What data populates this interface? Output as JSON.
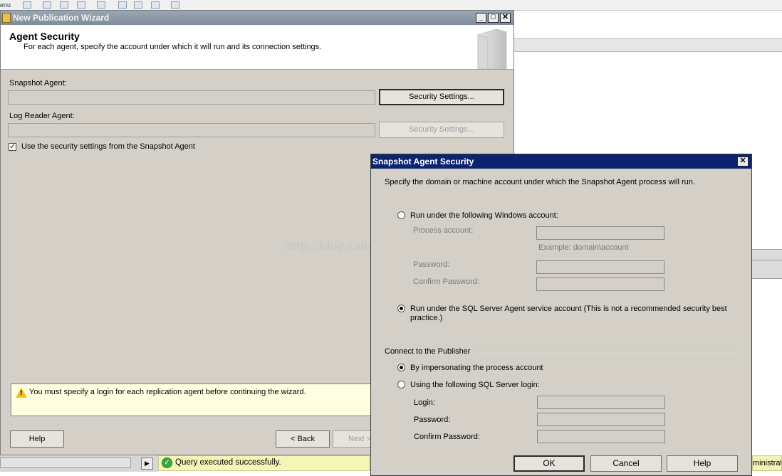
{
  "background": {
    "menu_fragment": "enu",
    "admin_fragment": "ministrato",
    "status_text": "Query executed successfully.",
    "scroll_arrow": "▶"
  },
  "wizard": {
    "title": "New Publication Wizard",
    "heading": "Agent Security",
    "subheading": "For each agent, specify the account under which it will run and its connection settings.",
    "snapshot_label": "Snapshot Agent:",
    "snapshot_value": "",
    "snapshot_button": "Security Settings...",
    "logreader_label": "Log Reader Agent:",
    "logreader_value": "",
    "logreader_button": "Security Settings...",
    "checkbox_label": "Use the security settings from the Snapshot Agent",
    "checkbox_checked": true,
    "warning": "You must specify a login for each replication agent before continuing the wizard.",
    "help_button": "Help",
    "back_button": "< Back",
    "next_button": "Next >",
    "min_glyph": "_",
    "max_glyph": "□",
    "close_glyph": "✕"
  },
  "watermark": "http://blog.csdn.net/DBA_Huangzj",
  "dialog": {
    "title": "Snapshot Agent Security",
    "close_glyph": "✕",
    "instruction": "Specify the domain or machine account under which the Snapshot Agent process will run.",
    "radio_windows": "Run under the following Windows account:",
    "process_account_label": "Process account:",
    "example": "Example: domain\\account",
    "password_label": "Password:",
    "confirm_password_label": "Confirm Password:",
    "radio_sqlagent": "Run under the SQL Server Agent service account (This is not a recommended security best practice.)",
    "group_label": "Connect to the Publisher",
    "radio_impersonate": "By impersonating the process account",
    "radio_sqllogin": "Using the following SQL Server login:",
    "login_label": "Login:",
    "login_password_label": "Password:",
    "login_confirm_label": "Confirm Password:",
    "ok_button": "OK",
    "cancel_button": "Cancel",
    "help_button": "Help",
    "selected_account_option": "Run under the SQL Server Agent service account",
    "selected_connect_option": "By impersonating the process account"
  },
  "colors": {
    "dialog_titlebar": "#0b2470",
    "wizard_titlebar": "#8f9bab",
    "warning_bg": "#ffffe1",
    "status_bg": "#f5f5b8"
  }
}
